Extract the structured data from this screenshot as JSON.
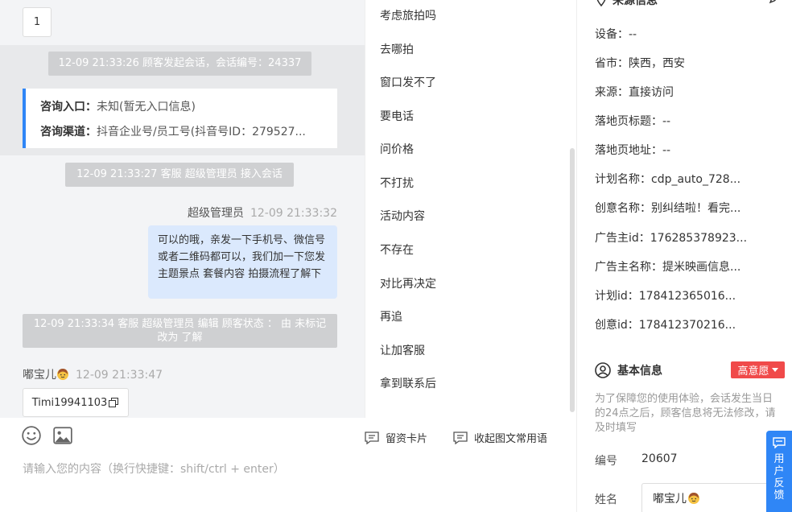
{
  "chat": {
    "page_chip": "1",
    "sys_start": "12-09 21:33:26 顾客发起会话，会话编号：24337",
    "entry_label": "咨询入口：",
    "entry_value": "未知(暂无入口信息)",
    "channel_label": "咨询渠道：",
    "channel_value": "抖音企业号/员工号(抖音号ID：279527...",
    "sys_join": "12-09 21:33:27 客服 超级管理员 接入会话",
    "agent_name": "超级管理员",
    "agent_time": "12-09 21:33:32",
    "agent_message": "可以的哦，亲发一下手机号、微信号或者二维码都可以，我们加一下您发主题景点 套餐内容 拍摄流程了解下",
    "sys_edit": "12-09 21:33:34 客服 超级管理员 编辑 顾客状态 ： 由 未标记 改为 了解",
    "customer_name": "嘟宝儿",
    "customer_time": "12-09 21:33:47",
    "customer_message": "Timi19941103"
  },
  "toolbar": {
    "card_label": "留资卡片",
    "collapse_label": "收起图文常用语"
  },
  "input": {
    "placeholder": "请输入您的内容（换行快捷键：shift/ctrl + enter）"
  },
  "phrases": [
    "考虑旅拍吗",
    "去哪拍",
    "窗口发不了",
    "要电话",
    "问价格",
    "不打扰",
    "活动内容",
    "不存在",
    "对比再决定",
    "再追",
    "让加客服",
    "拿到联系后"
  ],
  "source": {
    "title": "来源信息",
    "rows": [
      "设备：--",
      "省市：陕西，西安",
      "来源：直接访问",
      "落地页标题：--",
      "落地页地址：--",
      "计划名称：cdp_auto_728...",
      "创意名称：别纠结啦！看完...",
      "广告主id：176285378923...",
      "广告主名称：提米映画信息...",
      "计划id：178412365016...",
      "创意id：178412370216..."
    ]
  },
  "basic": {
    "title": "基本信息",
    "intent_badge": "高意愿",
    "notice": "为了保障您的使用体验，会话发生当日的24点之后，顾客信息将无法修改，请及时填写",
    "id_label": "编号",
    "id_value": "20607",
    "name_label": "姓名",
    "name_value": "嘟宝儿"
  },
  "feedback": {
    "label": "用户反馈"
  },
  "colors": {
    "accent": "#2f86f6",
    "badge": "#f04a4a",
    "bubble": "#dbe9fd"
  }
}
